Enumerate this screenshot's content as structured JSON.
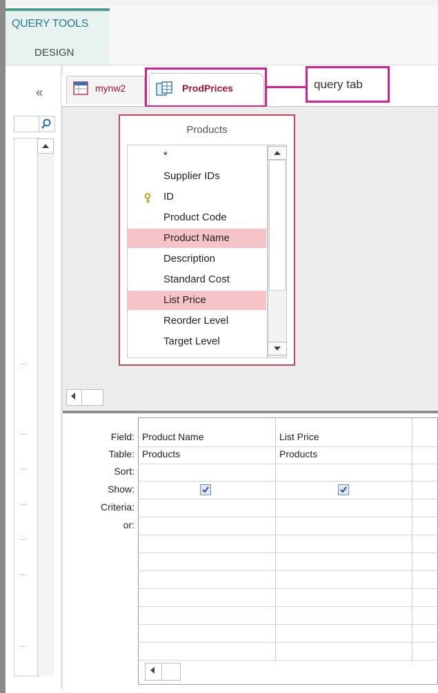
{
  "ribbon": {
    "context_title": "QUERY TOOLS",
    "design_tab": "DESIGN"
  },
  "nav": {
    "collapse_glyph": "«"
  },
  "tabs": [
    {
      "label": "mynw2",
      "icon": "table-icon"
    },
    {
      "label": "ProdPrices",
      "icon": "query-icon",
      "active": true
    }
  ],
  "callout": {
    "text": "query tab",
    "color": "#d6208c"
  },
  "field_list": {
    "title": "Products",
    "items": [
      {
        "label": "*",
        "highlighted": false,
        "key": false
      },
      {
        "label": "Supplier IDs",
        "highlighted": false,
        "key": false
      },
      {
        "label": "ID",
        "highlighted": false,
        "key": true
      },
      {
        "label": "Product Code",
        "highlighted": false,
        "key": false
      },
      {
        "label": "Product Name",
        "highlighted": true,
        "key": false
      },
      {
        "label": "Description",
        "highlighted": false,
        "key": false
      },
      {
        "label": "Standard Cost",
        "highlighted": false,
        "key": false
      },
      {
        "label": "List Price",
        "highlighted": true,
        "key": false
      },
      {
        "label": "Reorder Level",
        "highlighted": false,
        "key": false
      },
      {
        "label": "Target Level",
        "highlighted": false,
        "key": false
      }
    ]
  },
  "grid": {
    "row_labels": [
      "Field:",
      "Table:",
      "Sort:",
      "Show:",
      "Criteria:",
      "or:"
    ],
    "columns": [
      {
        "field": "Product Name",
        "table": "Products",
        "show": true
      },
      {
        "field": "List Price",
        "table": "Products",
        "show": true
      }
    ]
  },
  "colors": {
    "highlight": "#f6c4c8",
    "accent": "#4aa08c",
    "tab_text": "#b01030",
    "box_border": "#c14a5a"
  }
}
